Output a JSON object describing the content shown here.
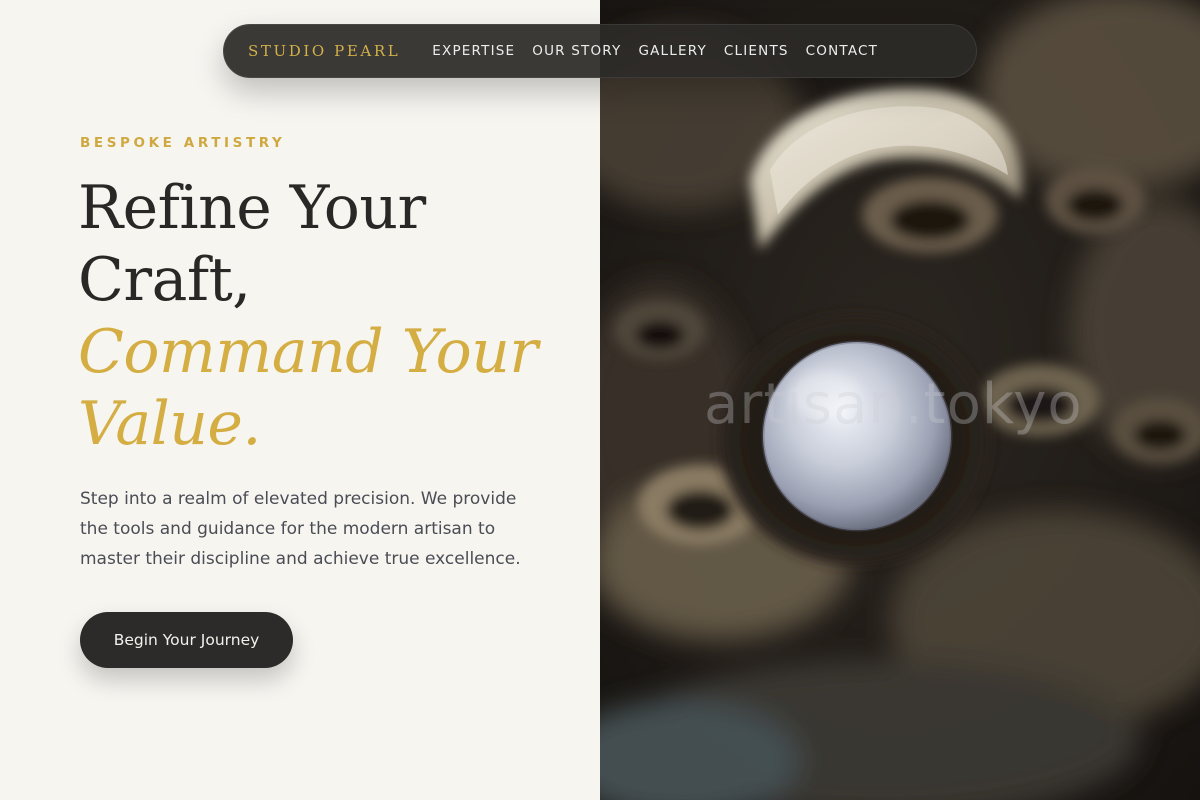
{
  "nav": {
    "brand": "STUDIO PEARL",
    "links": [
      "EXPERTISE",
      "OUR STORY",
      "GALLERY",
      "CLIENTS",
      "CONTACT"
    ]
  },
  "hero": {
    "eyebrow": "BESPOKE ARTISTRY",
    "headline_lines": [
      "Refine Your",
      "Craft,"
    ],
    "headline_accent_lines": [
      "Command Your",
      "Value."
    ],
    "description": "Step into a realm of elevated precision. We provide the tools and guidance for the modern artisan to master their discipline and achieve true excellence.",
    "cta_label": "Begin Your Journey"
  },
  "image": {
    "watermark": "artisan.tokyo",
    "subject": "pearl-in-oyster-photo"
  },
  "colors": {
    "accent_gold": "#d4ad43",
    "dark": "#2d2b29",
    "background": "#f7f5f0"
  }
}
